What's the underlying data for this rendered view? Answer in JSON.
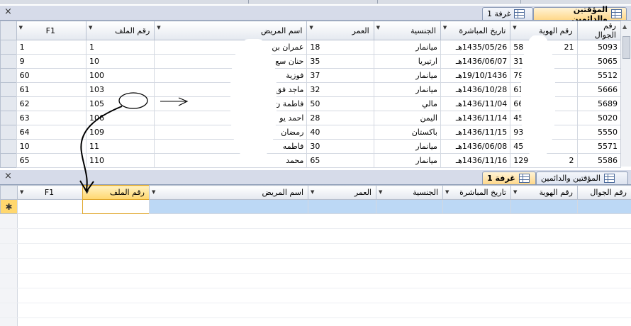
{
  "top_window": {
    "tabs": [
      {
        "label": "المؤقتين والدائمين",
        "active": true
      },
      {
        "label": "غرفة 1",
        "active": false
      }
    ],
    "close_label": "×",
    "columns": [
      "رقم الجوال",
      "رقم الهوية",
      "تاريخ المباشرة",
      "الجنسية",
      "العمر",
      "اسم المريض",
      "رقم الملف",
      "F1"
    ],
    "rows": [
      {
        "mobile": "5093",
        "id": "21",
        "id_end": "58",
        "date": "1435/05/26هـ",
        "nationality": "ميانمار",
        "age": "18",
        "name": "عمران بن",
        "file": "1",
        "f1": "1"
      },
      {
        "mobile": "5065",
        "id": "",
        "id_end": "31",
        "date": "1436/06/07هـ",
        "nationality": "ارتيريا",
        "age": "35",
        "name": "حنان سع",
        "file": "10",
        "f1": "9"
      },
      {
        "mobile": "5512",
        "id": "",
        "id_end": "79",
        "date": "19/10/1436هـ",
        "nationality": "ميانمار",
        "age": "37",
        "name": "فوزية",
        "file": "100",
        "f1": "60"
      },
      {
        "mobile": "5666",
        "id": "",
        "id_end": "61",
        "date": "1436/10/28هـ",
        "nationality": "ميانمار",
        "age": "32",
        "name": "ماجد فق",
        "file": "103",
        "f1": "61"
      },
      {
        "mobile": "5689",
        "id": "",
        "id_end": "66",
        "date": "1436/11/04هـ",
        "nationality": "مالي",
        "age": "50",
        "name": "فاطمة ن",
        "file": "105",
        "f1": "62"
      },
      {
        "mobile": "5020",
        "id": "",
        "id_end": "45",
        "date": "1436/11/14هـ",
        "nationality": "اليمن",
        "age": "28",
        "name": "احمد يو",
        "file": "106",
        "f1": "63"
      },
      {
        "mobile": "5550",
        "id": "",
        "id_end": "93",
        "date": "1436/11/15هـ",
        "nationality": "باكستان",
        "age": "40",
        "name": "رمضان",
        "file": "109",
        "f1": "64"
      },
      {
        "mobile": "5571",
        "id": "",
        "id_end": "45",
        "date": "1436/06/08هـ",
        "nationality": "ميانمار",
        "age": "30",
        "name": "فاطمه",
        "file": "11",
        "f1": "10"
      },
      {
        "mobile": "5586",
        "id": "2",
        "id_end": "129",
        "date": "1436/11/16هـ",
        "nationality": "ميانمار",
        "age": "65",
        "name": "محمد",
        "file": "110",
        "f1": "65"
      }
    ]
  },
  "bottom_window": {
    "tabs": [
      {
        "label": "غرفة 1",
        "active": true
      },
      {
        "label": "المؤقتين والدائمين",
        "active": false
      }
    ],
    "close_label": "×",
    "columns": [
      "رقم الجوال",
      "رقم الهوية",
      "تاريخ المباشرة",
      "الجنسية",
      "العمر",
      "اسم المريض",
      "رقم الملف",
      "F1"
    ],
    "new_row_marker": "✱"
  },
  "colors": {
    "accent_tab": "#ffd88a",
    "selection": "#e0a82e",
    "new_row": "#bcd8f5"
  }
}
